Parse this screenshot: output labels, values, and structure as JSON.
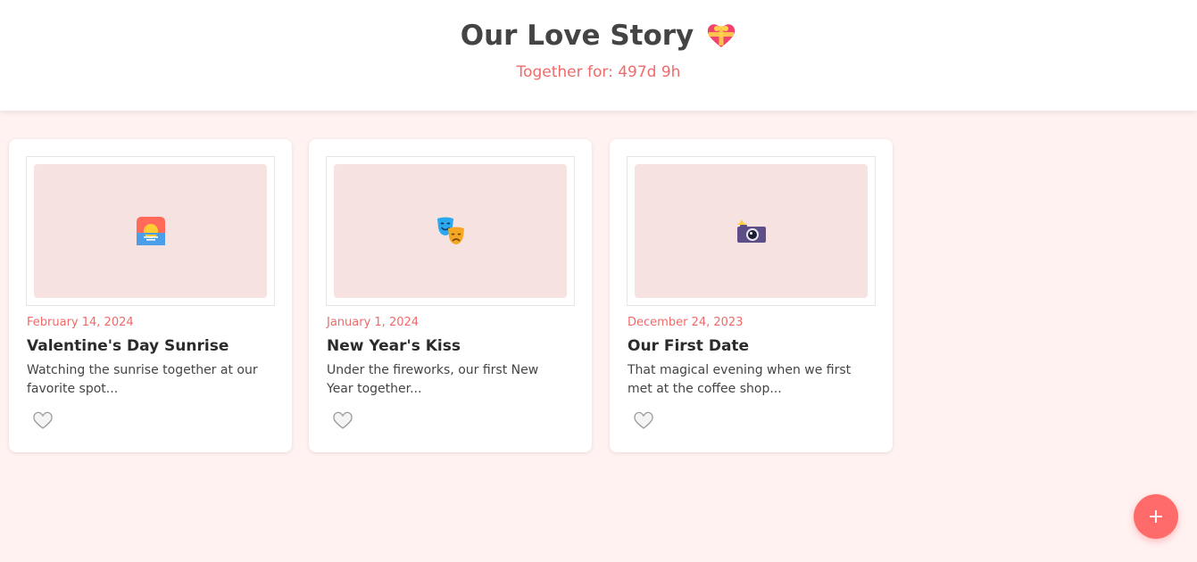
{
  "header": {
    "title": "Our Love Story",
    "title_icon": "heart-with-ribbon-icon",
    "counter_label": "Together for: ",
    "counter_value": "497d 9h"
  },
  "memories": [
    {
      "date": "February 14, 2024",
      "title": "Valentine's Day Sunrise",
      "description": "Watching the sunrise together at our favorite spot...",
      "icon": "sunrise-icon"
    },
    {
      "date": "January 1, 2024",
      "title": "New Year's Kiss",
      "description": "Under the fireworks, our first New Year together...",
      "icon": "theater-masks-icon"
    },
    {
      "date": "December 24, 2023",
      "title": "Our First Date",
      "description": "That magical evening when we first met at the coffee shop...",
      "icon": "camera-flash-icon"
    }
  ],
  "fab": {
    "label": "+"
  },
  "colors": {
    "accent": "#ff6b6b",
    "date_text": "#f06a6a",
    "page_background": "#fff2f1",
    "photo_placeholder": "#f6e2e1"
  }
}
